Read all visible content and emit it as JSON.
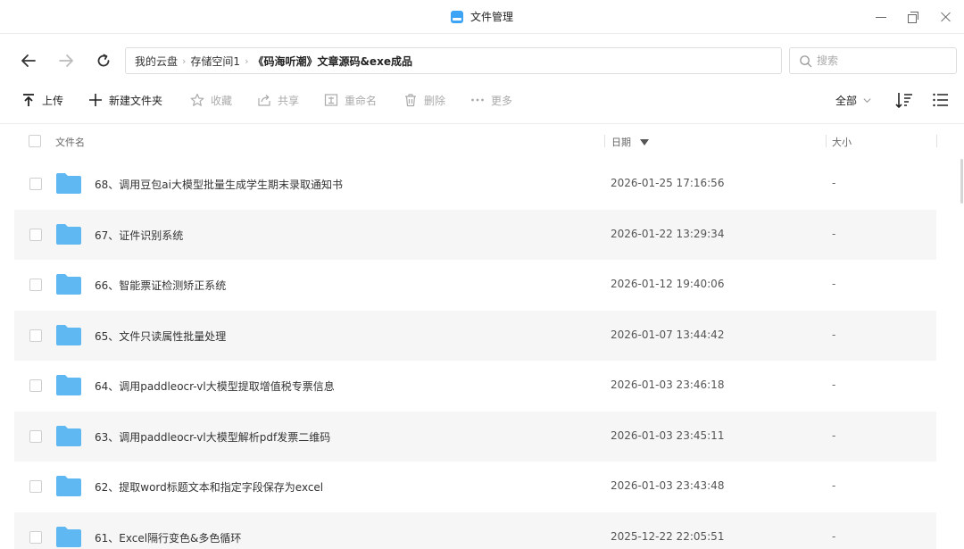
{
  "window": {
    "title": "文件管理",
    "icon": "app-drive-icon",
    "accent_color": "#3da3f5"
  },
  "nav": {
    "back_icon": "arrow-left-icon",
    "forward_icon": "arrow-right-icon",
    "refresh_icon": "refresh-icon",
    "breadcrumb": [
      "我的云盘",
      "存储空间1",
      "《码海听潮》文章源码&exe成品"
    ],
    "search_placeholder": "搜索"
  },
  "toolbar": {
    "upload": "上传",
    "new_folder": "新建文件夹",
    "favorite": "收藏",
    "share": "共享",
    "rename": "重命名",
    "delete": "删除",
    "more": "更多",
    "filter": "全部"
  },
  "list": {
    "headers": {
      "name": "文件名",
      "date": "日期",
      "size": "大小"
    },
    "sort": "date-descending",
    "rows": [
      {
        "name": "68、调用豆包ai大模型批量生成学生期末录取通知书",
        "date": "2026-01-25 17:16:56",
        "size": "-"
      },
      {
        "name": "67、证件识别系统",
        "date": "2026-01-22 13:29:34",
        "size": "-"
      },
      {
        "name": "66、智能票证检测矫正系统",
        "date": "2026-01-12 19:40:06",
        "size": "-"
      },
      {
        "name": "65、文件只读属性批量处理",
        "date": "2026-01-07 13:44:42",
        "size": "-"
      },
      {
        "name": "64、调用paddleocr-vl大模型提取增值税专票信息",
        "date": "2026-01-03 23:46:18",
        "size": "-"
      },
      {
        "name": "63、调用paddleocr-vl大模型解析pdf发票二维码",
        "date": "2026-01-03 23:45:11",
        "size": "-"
      },
      {
        "name": "62、提取word标题文本和指定字段保存为excel",
        "date": "2026-01-03 23:43:48",
        "size": "-"
      },
      {
        "name": "61、Excel隔行变色&多色循环",
        "date": "2025-12-22 22:05:51",
        "size": "-"
      }
    ],
    "folder_color": "#5fb8f2"
  }
}
